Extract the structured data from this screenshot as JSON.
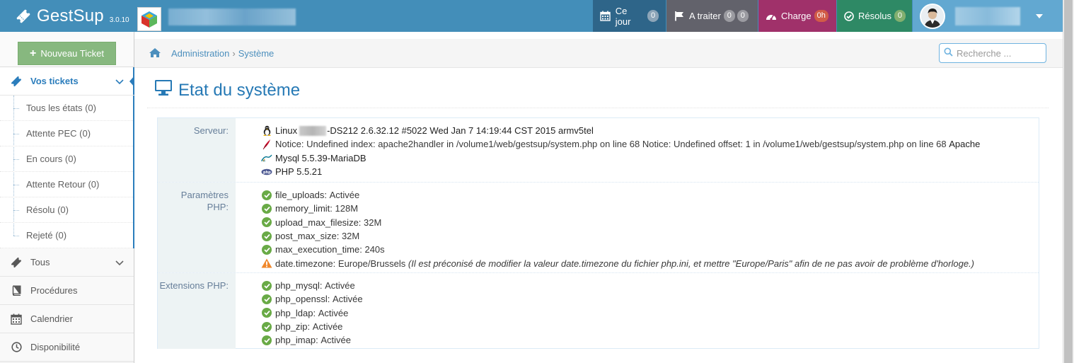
{
  "brand": {
    "name": "GestSup",
    "version": "3.0.10"
  },
  "topnav": {
    "items": [
      {
        "id": "ce-jour",
        "label": "Ce jour",
        "badges": [
          "0"
        ],
        "badge_colors": [
          "#8da5b8"
        ]
      },
      {
        "id": "a-traiter",
        "label": "A traiter",
        "badges": [
          "0",
          "0"
        ],
        "badge_colors": [
          "#9b9ba1",
          "#9b9ba1"
        ]
      },
      {
        "id": "charge",
        "label": "Charge",
        "badges": [
          "0h"
        ],
        "badge_colors": [
          "#d15b47"
        ]
      },
      {
        "id": "resolus",
        "label": "Résolus",
        "badges": [
          "0"
        ],
        "badge_colors": [
          "#82af6f"
        ]
      }
    ]
  },
  "sidebar": {
    "new_ticket_label": "Nouveau Ticket",
    "vos_tickets": "Vos tickets",
    "sub_items": [
      "Tous les états (0)",
      "Attente PEC (0)",
      "En cours (0)",
      "Attente Retour (0)",
      "Résolu (0)",
      "Rejeté (0)"
    ],
    "items": [
      "Tous",
      "Procédures",
      "Calendrier",
      "Disponibilité"
    ]
  },
  "breadcrumb": {
    "parent": "Administration",
    "current": "Système"
  },
  "search": {
    "placeholder": "Recherche ..."
  },
  "page": {
    "title": "Etat du système"
  },
  "server": {
    "label": "Serveur:",
    "linux_prefix": "Linux",
    "linux_suffix": "-DS212 2.6.32.12 #5022 Wed Jan 7 14:19:44 CST 2015 armv5tel",
    "notice": "Notice: Undefined index: apache2handler in /volume1/web/gestsup/system.php on line 68 Notice: Undefined offset: 1 in /volume1/web/gestsup/system.php on line 68",
    "apache": "Apache",
    "mysql": "Mysql 5.5.39-MariaDB",
    "php": "PHP 5.5.21"
  },
  "php_params": {
    "label_line1": "Paramètres",
    "label_line2": "PHP:",
    "rows": [
      {
        "key": "file_uploads:",
        "value": "Activée"
      },
      {
        "key": "memory_limit:",
        "value": "128M"
      },
      {
        "key": "upload_max_filesize:",
        "value": "32M"
      },
      {
        "key": "post_max_size:",
        "value": "32M"
      },
      {
        "key": "max_execution_time:",
        "value": "240s"
      }
    ],
    "timezone_key": "date.timezone:",
    "timezone_value": "Europe/Brussels",
    "timezone_note": "(Il est préconisé de modifier la valeur date.timezone du fichier php.ini, et mettre \"Europe/Paris\" afin de ne pas avoir de problème d'horloge.)"
  },
  "php_ext": {
    "label": "Extensions PHP:",
    "rows": [
      {
        "key": "php_mysql:",
        "value": "Activée"
      },
      {
        "key": "php_openssl:",
        "value": "Activée"
      },
      {
        "key": "php_ldap:",
        "value": "Activée"
      },
      {
        "key": "php_zip:",
        "value": "Activée"
      },
      {
        "key": "php_imap:",
        "value": "Activée"
      }
    ]
  },
  "colors": {
    "navbar": "#438eb9",
    "accent": "#2679b5",
    "success": "#69aa46",
    "warning": "#f0882c"
  }
}
